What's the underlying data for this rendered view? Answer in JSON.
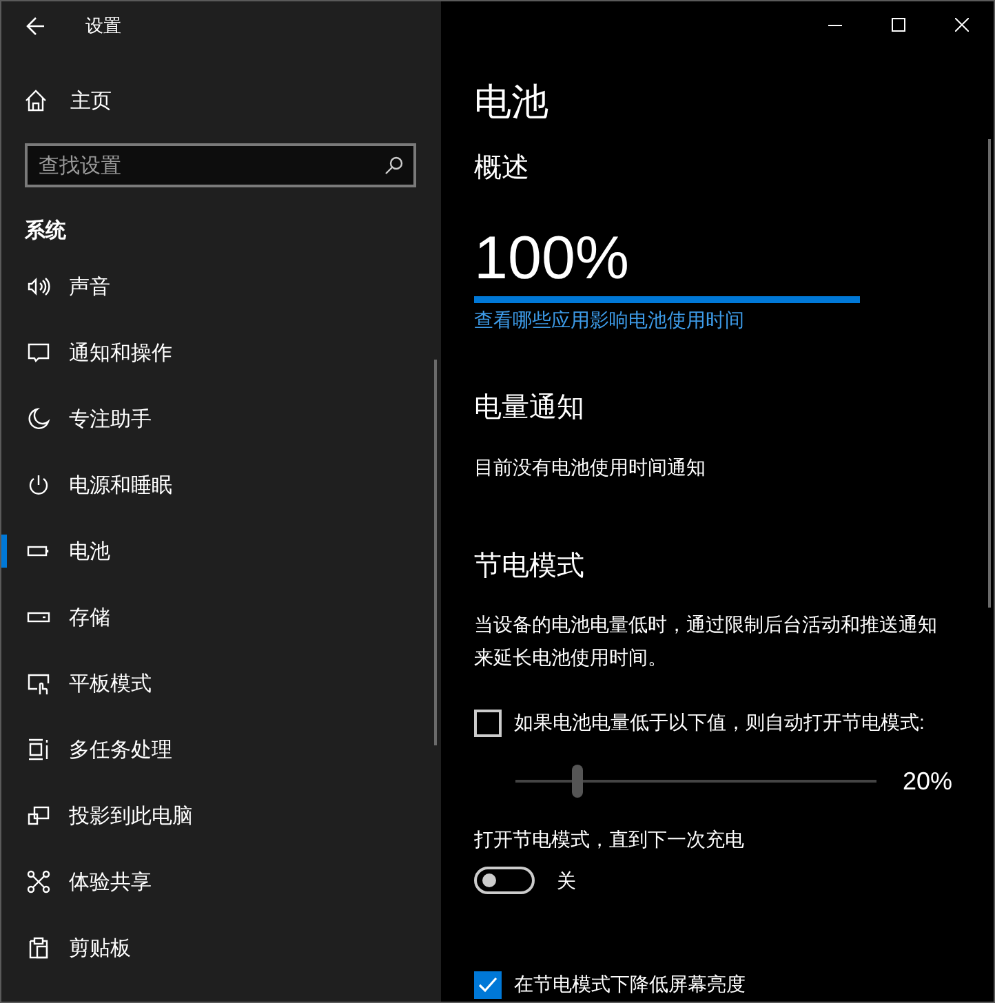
{
  "window": {
    "title": "设置"
  },
  "sidebar": {
    "home": "主页",
    "search": {
      "placeholder": "查找设置"
    },
    "section": "系统",
    "items": [
      {
        "label": "声音",
        "selected": false
      },
      {
        "label": "通知和操作",
        "selected": false
      },
      {
        "label": "专注助手",
        "selected": false
      },
      {
        "label": "电源和睡眠",
        "selected": false
      },
      {
        "label": "电池",
        "selected": true
      },
      {
        "label": "存储",
        "selected": false
      },
      {
        "label": "平板模式",
        "selected": false
      },
      {
        "label": "多任务处理",
        "selected": false
      },
      {
        "label": "投影到此电脑",
        "selected": false
      },
      {
        "label": "体验共享",
        "selected": false
      },
      {
        "label": "剪贴板",
        "selected": false
      }
    ]
  },
  "page": {
    "title": "电池",
    "overview": {
      "heading": "概述",
      "percent": "100%",
      "level": 1,
      "link": "查看哪些应用影响电池使用时间"
    },
    "notifications": {
      "heading": "电量通知",
      "text": "目前没有电池使用时间通知"
    },
    "saver": {
      "heading": "节电模式",
      "description": "当设备的电池电量低时，通过限制后台活动和推送通知来延长电池使用时间。",
      "auto": {
        "label": "如果电池电量低于以下值，则自动打开节电模式:",
        "checked": false
      },
      "threshold": {
        "level": 0.17,
        "reading": "20%"
      },
      "until_charge": {
        "label": "打开节电模式，直到下一次充电",
        "on": false,
        "state": "关"
      },
      "dim": {
        "label": "在节电模式下降低屏幕亮度",
        "checked": true
      }
    }
  }
}
